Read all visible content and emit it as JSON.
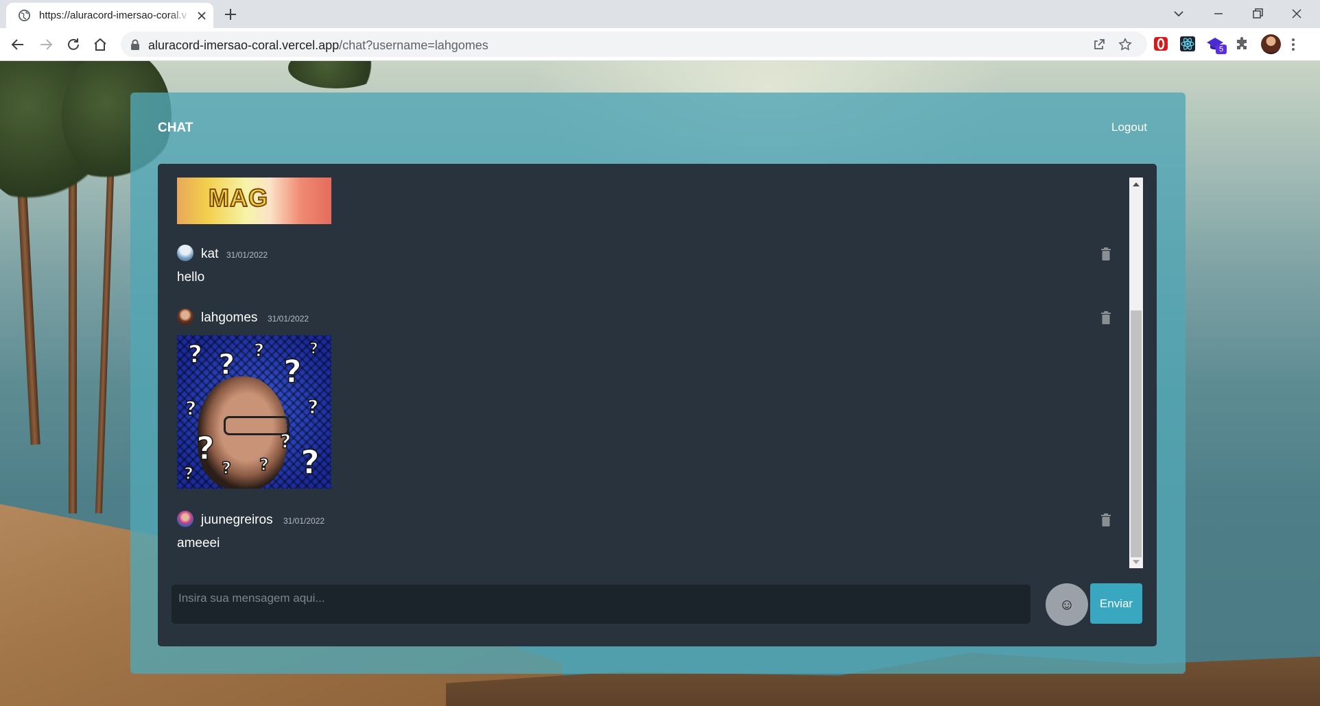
{
  "browser": {
    "tab_title": "https://aluracord-imersao-coral.v",
    "url_host": "aluracord-imersao-coral.vercel.app",
    "url_path": "/chat?username=lahgomes",
    "extension_badge": "5"
  },
  "chat": {
    "title": "CHAT",
    "logout_label": "Logout",
    "top_image_text": "MAG",
    "messages": [
      {
        "author": "kat",
        "date": "31/01/2022",
        "text": "hello"
      },
      {
        "author": "lahgomes",
        "date": "31/01/2022",
        "text": ""
      },
      {
        "author": "juunegreiros",
        "date": "31/01/2022",
        "text": "ameeei"
      }
    ],
    "input_placeholder": "Insira sua mensagem aqui...",
    "emoji_icon": "☺",
    "send_label": "Enviar"
  },
  "colors": {
    "frame": "#52a6b5",
    "panel": "#29333d",
    "send_button": "#3aa7c0"
  }
}
